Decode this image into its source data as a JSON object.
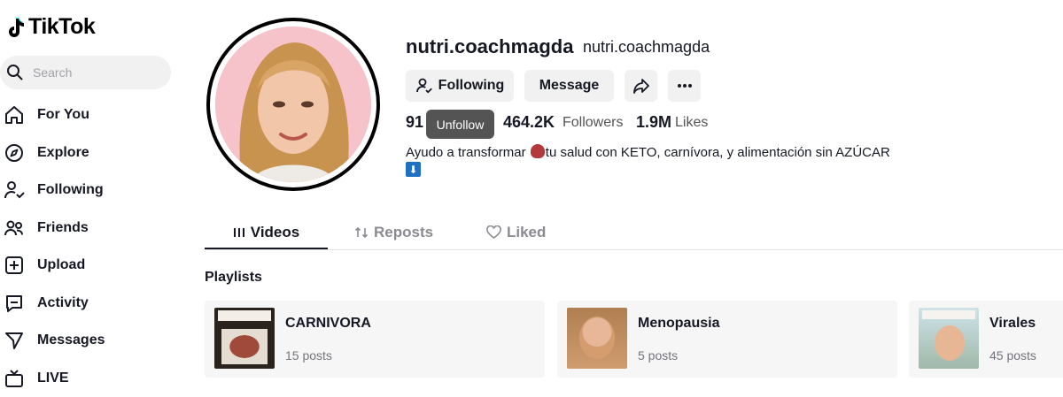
{
  "brand": {
    "name": "TikTok"
  },
  "search": {
    "placeholder": "Search"
  },
  "nav": [
    {
      "label": "For You",
      "icon": "home-icon"
    },
    {
      "label": "Explore",
      "icon": "compass-icon"
    },
    {
      "label": "Following",
      "icon": "following-icon"
    },
    {
      "label": "Friends",
      "icon": "friends-icon"
    },
    {
      "label": "Upload",
      "icon": "upload-icon"
    },
    {
      "label": "Activity",
      "icon": "activity-icon"
    },
    {
      "label": "Messages",
      "icon": "messages-icon"
    },
    {
      "label": "LIVE",
      "icon": "live-icon"
    }
  ],
  "profile": {
    "username": "nutri.coachmagda",
    "nickname": "nutri.coachmagda",
    "following_button": "Following",
    "message_button": "Message",
    "tooltip": "Unfollow",
    "stats": {
      "following_count": "91",
      "followers_count": "464.2K",
      "followers_label": "Followers",
      "likes_count": "1.9M",
      "likes_label": "Likes"
    },
    "bio_part1": "Ayudo a transformar ",
    "bio_part2": "tu salud con KETO, carnívora, y alimentación sin AZÚCAR",
    "bio_arrow": "⬇"
  },
  "tabs": [
    {
      "label": "Videos",
      "icon": "grid-icon",
      "active": true
    },
    {
      "label": "Reposts",
      "icon": "repost-icon",
      "active": false
    },
    {
      "label": "Liked",
      "icon": "heart-icon",
      "active": false
    }
  ],
  "playlists": {
    "title": "Playlists",
    "items": [
      {
        "name": "CARNIVORA",
        "count": "15 posts"
      },
      {
        "name": "Menopausia",
        "count": "5 posts"
      },
      {
        "name": "Virales",
        "count": "45 posts"
      }
    ]
  },
  "colors": {
    "text": "#161823",
    "muted": "#8a8b91",
    "button_bg": "#f1f1f2"
  }
}
